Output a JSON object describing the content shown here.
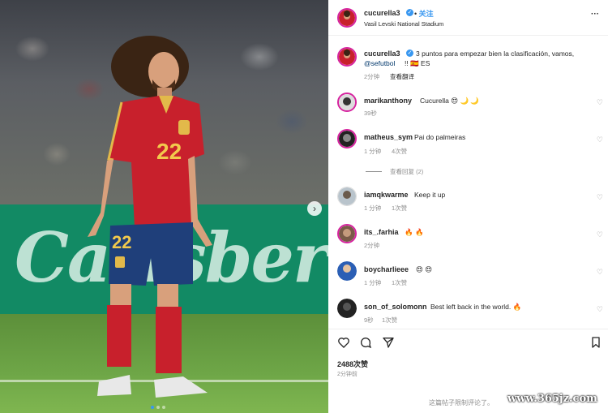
{
  "post": {
    "photo_alt": "Footballer in red Spain jersey number 22",
    "jersey_number": "22",
    "board_text": "Carlsberg",
    "nav_arrow": "›"
  },
  "header": {
    "username": "cucurella3",
    "follow_label": "关注",
    "location": "Vasil Levski National Stadium",
    "more_label": "···"
  },
  "caption": {
    "username": "cucurella3",
    "text": "3 puntos para empezar bien la clasificación, vamos,",
    "mention": "@sefutbol",
    "suffix": "!! 🇪🇸 ES",
    "time": "2分钟",
    "translate_label": "查看翻译"
  },
  "comments": [
    {
      "username": "marikanthony",
      "text": "Cucurella 😍 🌙 🌙",
      "time": "39秒",
      "likes": ""
    },
    {
      "username": "matheus_sym",
      "text": "Pai do palmeiras",
      "time": "1 分钟",
      "likes": "4次赞"
    },
    {
      "username": "iamqkwarme",
      "text": "Keep it up",
      "time": "1 分钟",
      "likes": "1次赞"
    },
    {
      "username": "its_.farhia",
      "text": "🔥 🔥",
      "time": "2分钟",
      "likes": ""
    },
    {
      "username": "boycharlieee",
      "text": "😍 😍",
      "time": "1 分钟",
      "likes": "1次赞"
    },
    {
      "username": "son_of_solomonn",
      "text": "Best left back in the world. 🔥",
      "time": "9秒",
      "likes": "1次赞"
    }
  ],
  "view_replies_label": "查看回复 (2)",
  "footer": {
    "likes_count": "2488次赞",
    "posted_time": "2分钟前",
    "limited_label": "这篇帖子限制评论了。"
  },
  "watermark": "www.365jz.com",
  "colors": {
    "accent": "#3897f0",
    "jersey_red": "#c8202c",
    "shorts_blue": "#1f3f7a",
    "board_green": "#128a64"
  }
}
